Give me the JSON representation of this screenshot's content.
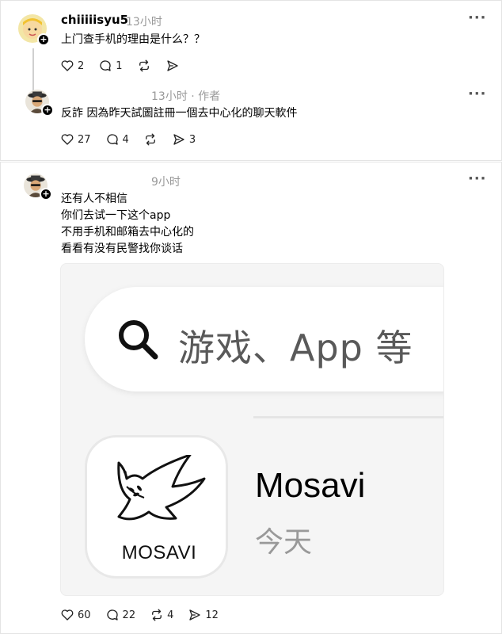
{
  "post1": {
    "username": "chiiiiisyu5",
    "time": "13小时",
    "more": "···",
    "text": "上门查手机的理由是什么？？",
    "likes": "2",
    "comments": "1"
  },
  "reply1": {
    "meta": "13小时 · 作者",
    "more": "···",
    "text": "反詐 因為昨天試圖註冊一個去中心化的聊天軟件",
    "likes": "27",
    "comments": "4",
    "shares": "3"
  },
  "post2": {
    "time": "9小时",
    "more": "···",
    "lines": [
      "还有人不相信",
      "你们去试一下这个app",
      "不用手机和邮箱去中心化的",
      "看看有没有民警找你谈话"
    ],
    "likes": "60",
    "comments": "22",
    "reposts": "4",
    "shares": "12"
  },
  "embed": {
    "search_placeholder": "游戏、App 等",
    "logo_text": "MOSAVI",
    "app_name": "Mosavi",
    "app_subtitle": "今天"
  },
  "icons": {
    "like": "heart-icon",
    "comment": "comment-icon",
    "repost": "repost-icon",
    "share": "send-icon",
    "follow": "plus-icon",
    "search": "search-icon",
    "logo": "dove-icon"
  }
}
